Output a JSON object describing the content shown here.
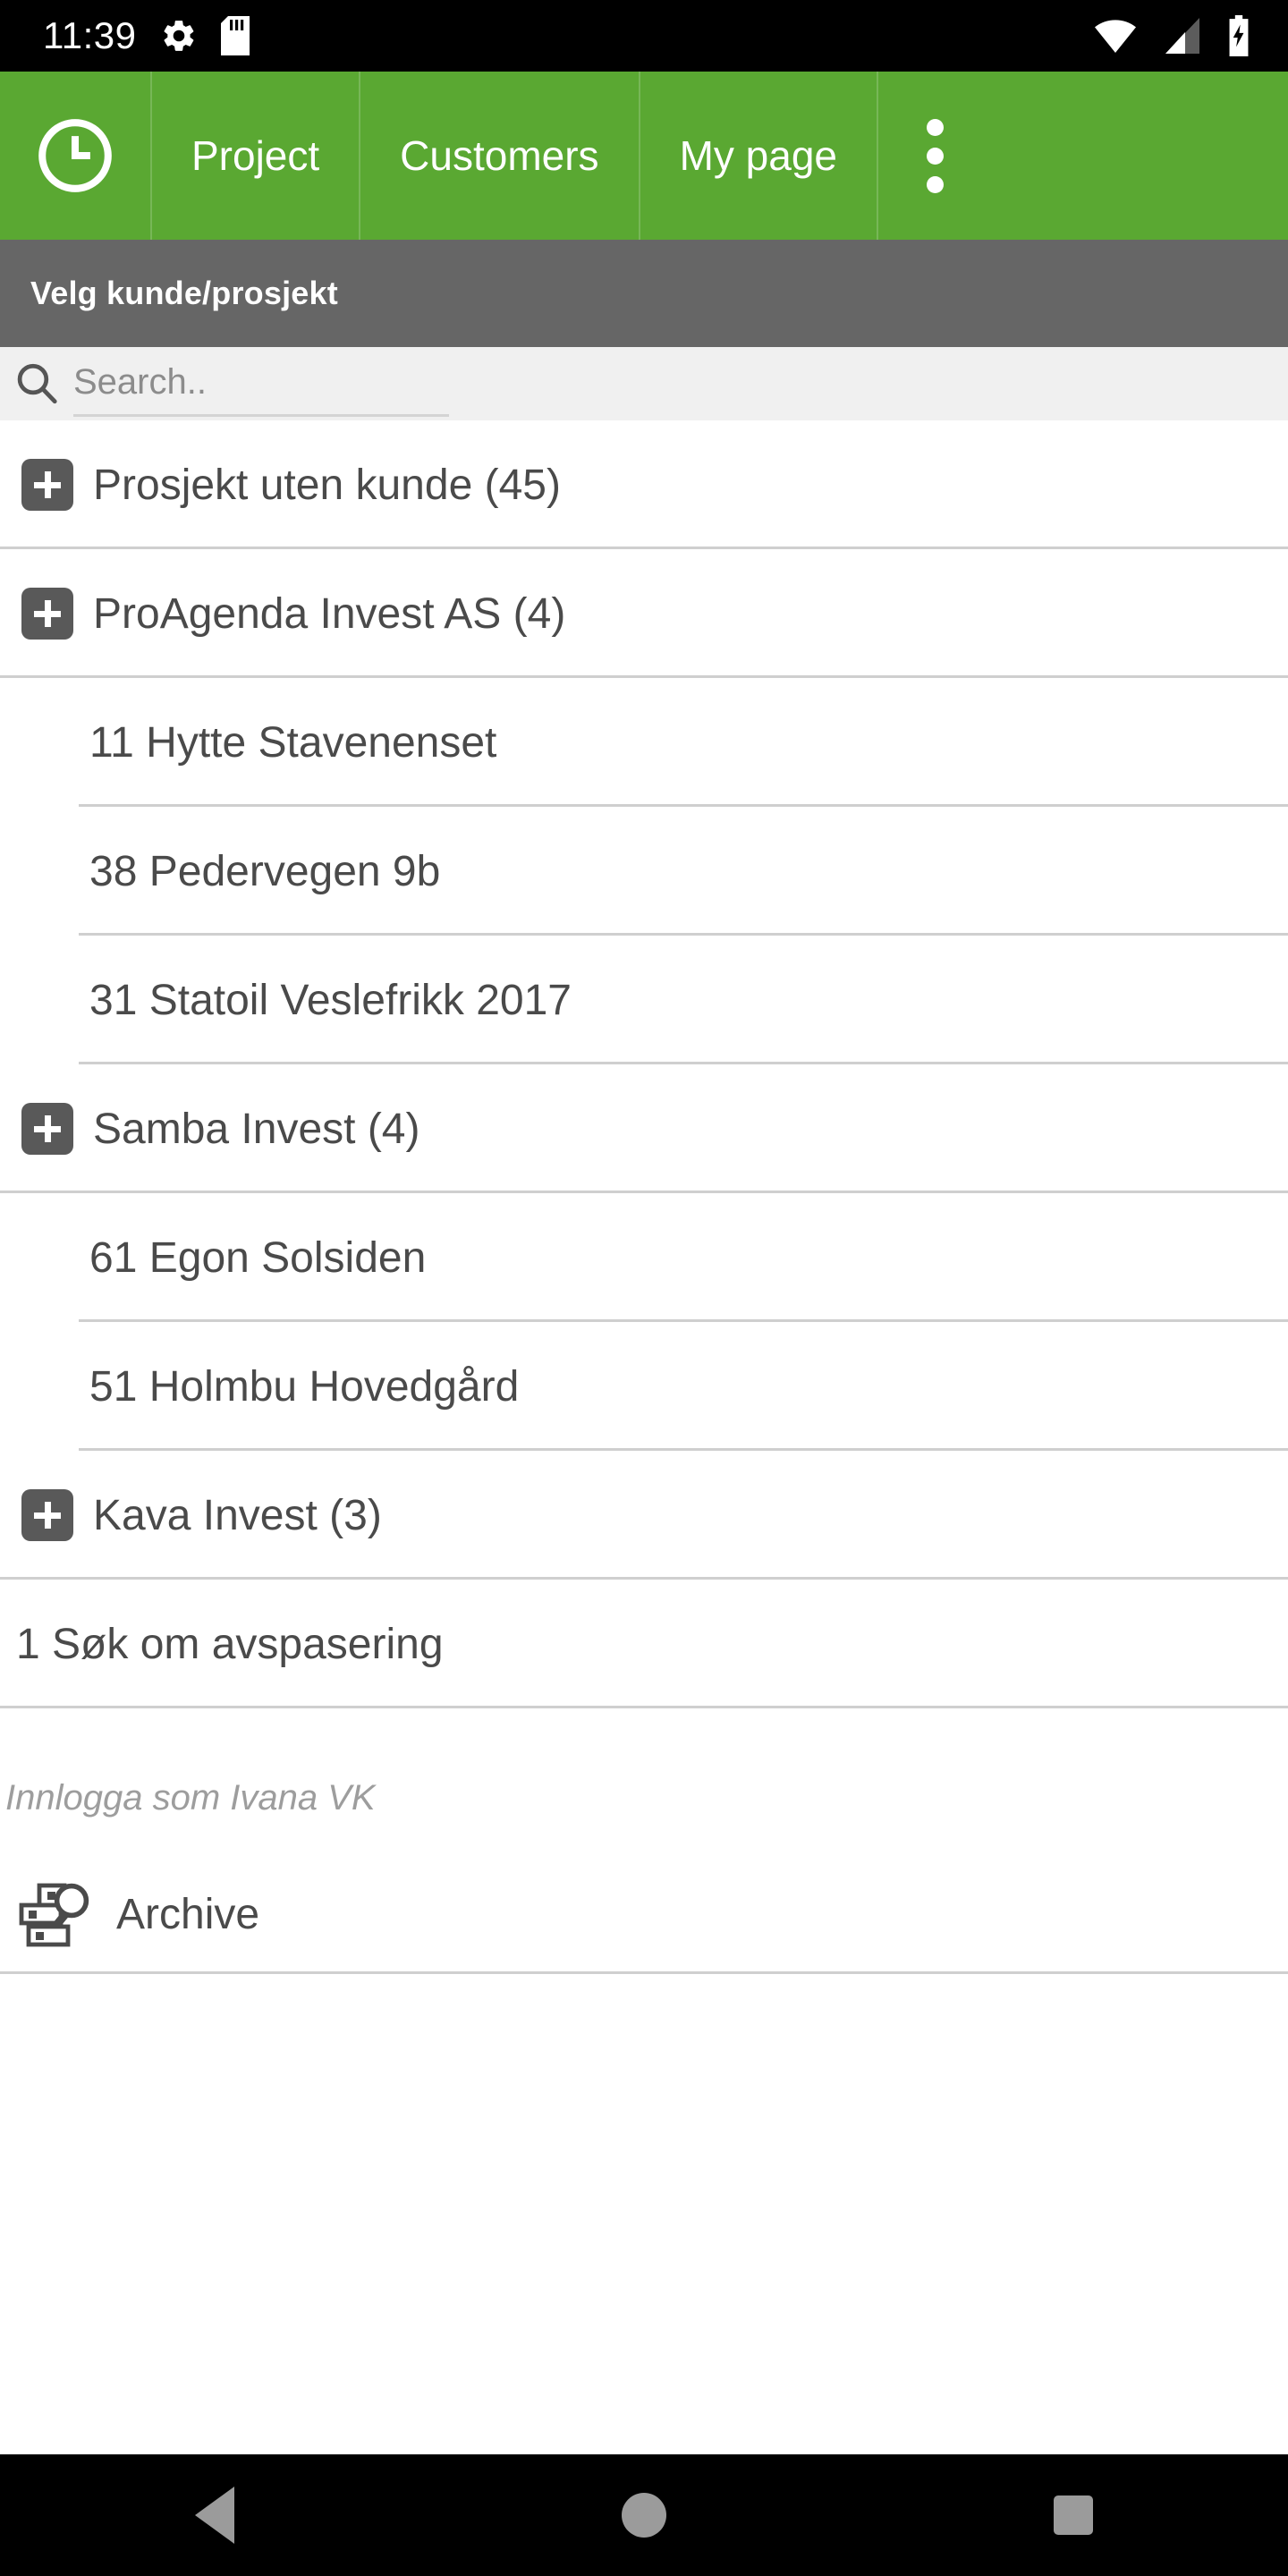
{
  "statusbar": {
    "time": "11:39",
    "left_icons": [
      "gear-icon",
      "sd-card-icon"
    ],
    "right_icons": [
      "wifi-icon",
      "cellular-signal-icon",
      "battery-charging-icon"
    ]
  },
  "appbar": {
    "logo_icon": "clock-icon",
    "tabs": [
      {
        "label": "Project"
      },
      {
        "label": "Customers"
      },
      {
        "label": "My page"
      }
    ],
    "overflow_icon": "overflow-menu-icon",
    "background_color": "#5aa832"
  },
  "subheader": {
    "title": "Velg kunde/prosjekt",
    "background_color": "#666666"
  },
  "search": {
    "placeholder": "Search..",
    "value": "",
    "icon": "search-icon"
  },
  "list": {
    "rows": [
      {
        "type": "group",
        "label": "Prosjekt uten kunde (45)",
        "expand_icon": "plus-icon"
      },
      {
        "type": "group",
        "label": "ProAgenda Invest AS (4)",
        "expand_icon": "plus-icon"
      },
      {
        "type": "child",
        "label": "11 Hytte Stavenenset"
      },
      {
        "type": "child",
        "label": "38 Pedervegen 9b"
      },
      {
        "type": "child",
        "label": "31 Statoil Veslefrikk 2017"
      },
      {
        "type": "group",
        "label": "Samba Invest (4)",
        "expand_icon": "plus-icon"
      },
      {
        "type": "child",
        "label": "61 Egon Solsiden"
      },
      {
        "type": "child",
        "label": "51 Holmbu Hovedgård"
      },
      {
        "type": "group",
        "label": "Kava Invest (3)",
        "expand_icon": "plus-icon"
      },
      {
        "type": "plain",
        "label": "1 Søk om avspasering"
      }
    ]
  },
  "footer": {
    "logged_in_text": "Innlogga som Ivana VK",
    "archive_label": "Archive",
    "archive_icon": "archive-icon"
  },
  "navbar": {
    "back_label": "Back",
    "home_label": "Home",
    "recents_label": "Recents",
    "icon_color": "#9b9b9b"
  }
}
